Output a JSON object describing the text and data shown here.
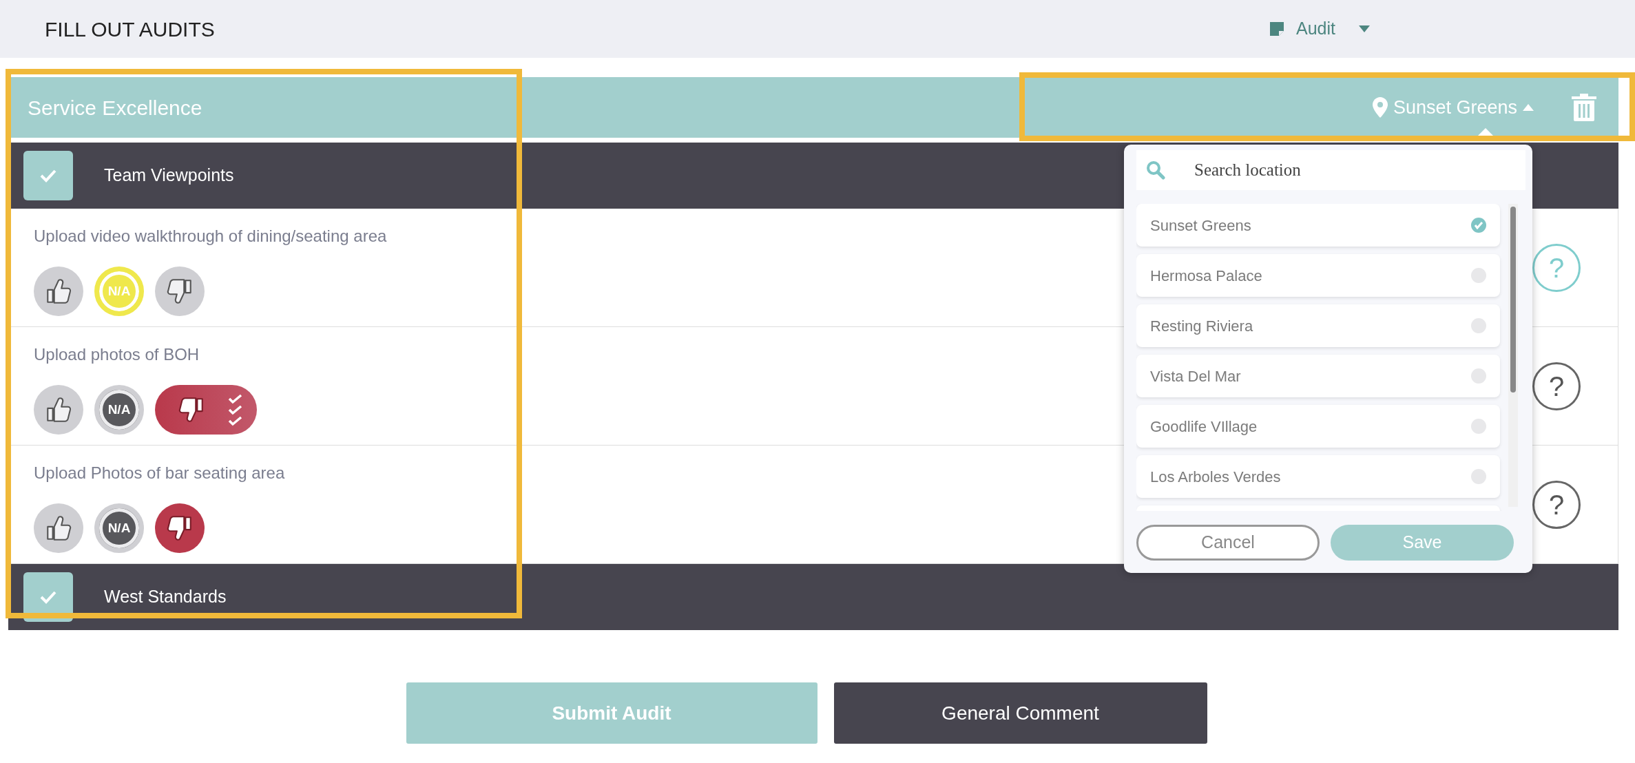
{
  "header": {
    "title": "FILL OUT AUDITS",
    "menu": {
      "label": "Audit"
    }
  },
  "section": {
    "title": "Service Excellence",
    "location": {
      "label": "Sunset Greens",
      "expanded": true
    }
  },
  "categories": [
    {
      "label": "Team Viewpoints",
      "checked": true,
      "questions": [
        {
          "text": "Upload video walkthrough of dining/seating area",
          "options": [
            {
              "kind": "up",
              "selected": false
            },
            {
              "kind": "na",
              "label": "N/A",
              "selected": true
            },
            {
              "kind": "down",
              "selected": false,
              "checklist": false
            }
          ],
          "help": {
            "label": "?",
            "active": true
          }
        },
        {
          "text": "Upload photos of BOH",
          "options": [
            {
              "kind": "up",
              "selected": false
            },
            {
              "kind": "na",
              "label": "N/A",
              "selected": false
            },
            {
              "kind": "down",
              "selected": true,
              "checklist": true
            }
          ],
          "help": {
            "label": "?",
            "active": false
          }
        },
        {
          "text": "Upload Photos of bar seating area",
          "options": [
            {
              "kind": "up",
              "selected": false
            },
            {
              "kind": "na",
              "label": "N/A",
              "selected": false
            },
            {
              "kind": "down",
              "selected": true,
              "checklist": false
            }
          ],
          "help": {
            "label": "?",
            "active": false
          }
        }
      ]
    },
    {
      "label": "West Standards",
      "checked": true
    }
  ],
  "location_dropdown": {
    "search": {
      "placeholder": "Search location"
    },
    "items": [
      {
        "label": "Sunset Greens",
        "selected": true
      },
      {
        "label": "Hermosa Palace",
        "selected": false
      },
      {
        "label": "Resting Riviera",
        "selected": false
      },
      {
        "label": "Vista Del Mar",
        "selected": false
      },
      {
        "label": "Goodlife VIllage",
        "selected": false
      },
      {
        "label": "Los Arboles Verdes",
        "selected": false
      }
    ],
    "buttons": [
      {
        "label": "Cancel",
        "kind": "secondary"
      },
      {
        "label": "Save",
        "kind": "primary"
      }
    ]
  },
  "actions": [
    {
      "label": "Submit Audit",
      "kind": "primary"
    },
    {
      "label": "General Comment",
      "kind": "dark"
    }
  ]
}
